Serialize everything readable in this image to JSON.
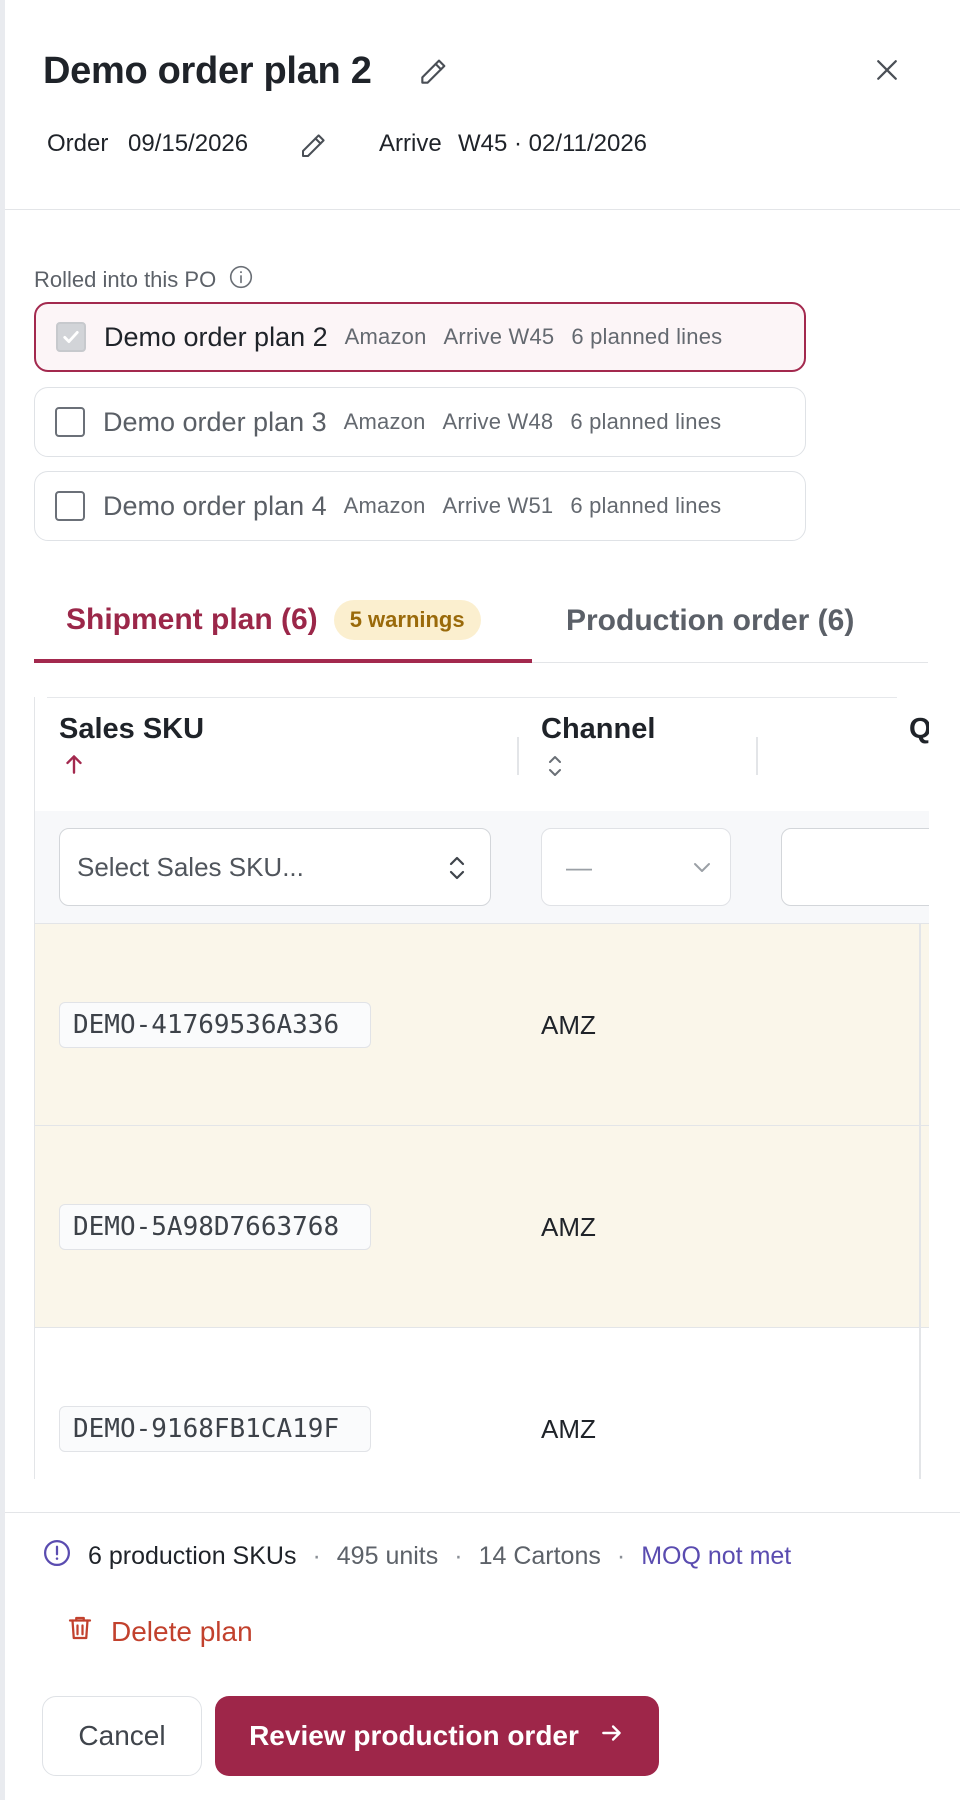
{
  "header": {
    "title": "Demo order plan 2",
    "order_label": "Order",
    "order_date": "09/15/2026",
    "arrive_label": "Arrive",
    "arrive_value": "W45 · 02/11/2026"
  },
  "rolled": {
    "label": "Rolled into this PO",
    "plans": [
      {
        "name": "Demo order plan 2",
        "channel": "Amazon",
        "arrive": "Arrive W45",
        "lines": "6 planned lines",
        "checked": true
      },
      {
        "name": "Demo order plan 3",
        "channel": "Amazon",
        "arrive": "Arrive W48",
        "lines": "6 planned lines",
        "checked": false
      },
      {
        "name": "Demo order plan 4",
        "channel": "Amazon",
        "arrive": "Arrive W51",
        "lines": "6 planned lines",
        "checked": false
      }
    ]
  },
  "tabs": {
    "shipment": "Shipment plan (6)",
    "warnings": "5 warnings",
    "production": "Production order (6)"
  },
  "table": {
    "columns": [
      "Sales SKU",
      "Channel",
      "Q"
    ],
    "filters": {
      "sku_placeholder": "Select Sales SKU...",
      "channel_value": "—"
    },
    "rows": [
      {
        "sku": "DEMO-41769536A336",
        "channel": "AMZ",
        "warning": true
      },
      {
        "sku": "DEMO-5A98D7663768",
        "channel": "AMZ",
        "warning": true
      },
      {
        "sku": "DEMO-9168FB1CA19F",
        "channel": "AMZ",
        "warning": false
      }
    ]
  },
  "footer": {
    "prod_skus": "6 production SKUs",
    "units": "495 units",
    "cartons": "14 Cartons",
    "moq": "MOQ not met",
    "delete": "Delete plan",
    "cancel": "Cancel",
    "review": "Review production order"
  },
  "colors": {
    "accent": "#9e2649",
    "warning_bg": "#faf6ea",
    "badge_bg": "#fbefcf",
    "moq": "#5a4cb0",
    "danger": "#c2412d"
  }
}
